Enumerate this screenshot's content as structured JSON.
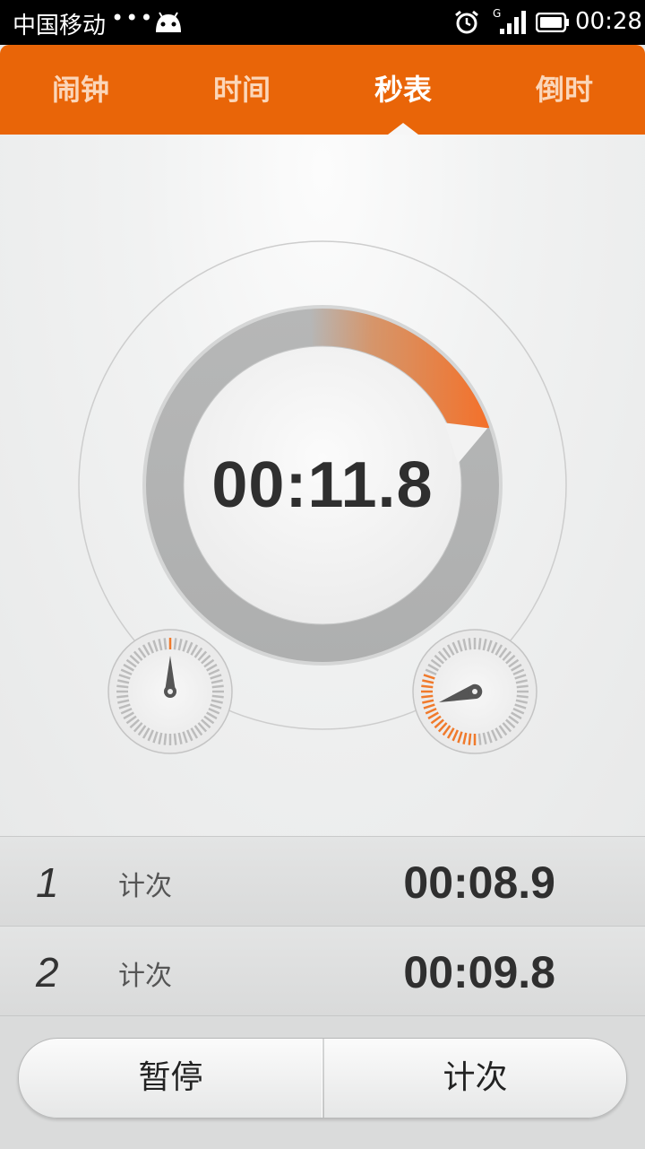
{
  "status_bar": {
    "carrier": "中国移动",
    "dots": "•••",
    "time": "00:28"
  },
  "tabs": [
    {
      "label": "闹钟",
      "active": false
    },
    {
      "label": "时间",
      "active": false
    },
    {
      "label": "秒表",
      "active": true
    },
    {
      "label": "倒时",
      "active": false
    }
  ],
  "stopwatch": {
    "elapsed": "00:11.8",
    "progress_fraction": 0.197,
    "accent_color": "#f07a2c"
  },
  "laps": [
    {
      "number": "1",
      "label": "计次",
      "time": "00:08.9"
    },
    {
      "number": "2",
      "label": "计次",
      "time": "00:09.8"
    }
  ],
  "controls": {
    "pause_label": "暂停",
    "lap_label": "计次"
  },
  "colors": {
    "brand": "#e96508",
    "status_bar": "#000000"
  }
}
